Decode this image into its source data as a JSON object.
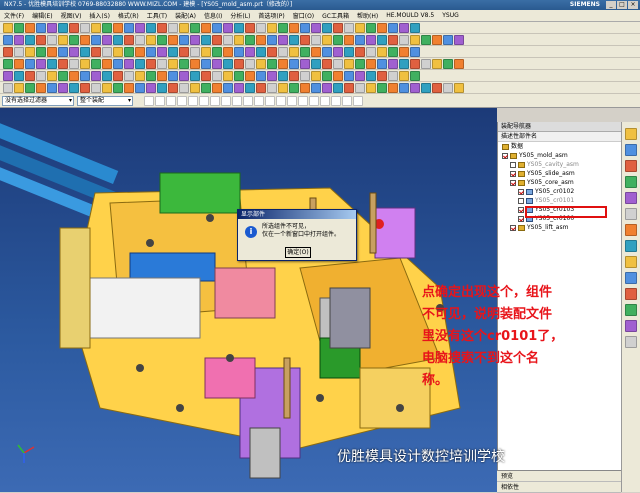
{
  "window": {
    "title": "NX7.5 - 优胜模具培训学校 0769-88032880 WWW.MIZL.COM - 建模 - [YS05_mold_asm.prt（修改的）]",
    "brand": "SIEMENS",
    "win_buttons": [
      "_",
      "□",
      "×"
    ]
  },
  "menu": [
    "文件(F)",
    "编辑(E)",
    "视图(V)",
    "插入(S)",
    "格式(R)",
    "工具(T)",
    "装配(A)",
    "信息(I)",
    "分析(L)",
    "首选项(P)",
    "窗口(O)",
    "GC工具箱",
    "帮助(H)",
    "HE.MOULD V8.5",
    "YSUG"
  ],
  "selection": {
    "filter_value": "没有选择过滤器",
    "scope_value": "整个装配"
  },
  "navigator": {
    "title": "装配导航器",
    "column": "描述性部件名",
    "items": [
      {
        "label": "数据",
        "kind": "folder",
        "indent": 0,
        "checked": false
      },
      {
        "label": "YS05_mold_asm",
        "kind": "asm",
        "indent": 0,
        "checked": true
      },
      {
        "label": "YS05_cavity_asm",
        "kind": "asm",
        "indent": 1,
        "checked": false
      },
      {
        "label": "YS05_slide_asm",
        "kind": "asm",
        "indent": 1,
        "checked": true
      },
      {
        "label": "YS05_core_asm",
        "kind": "asm",
        "indent": 1,
        "checked": true
      },
      {
        "label": "YS05_cr0102",
        "kind": "prt",
        "indent": 2,
        "checked": true
      },
      {
        "label": "YS05_cr0101",
        "kind": "prt",
        "indent": 2,
        "checked": false,
        "highlight": true
      },
      {
        "label": "YS05_cr0103",
        "kind": "prt",
        "indent": 2,
        "checked": true
      },
      {
        "label": "YS05_cr0100",
        "kind": "prt",
        "indent": 2,
        "checked": true
      },
      {
        "label": "YS05_lift_asm",
        "kind": "asm",
        "indent": 1,
        "checked": true
      }
    ],
    "bottom": [
      "预览",
      "相依性"
    ]
  },
  "dialog": {
    "title": "显示部件",
    "lines": [
      "所选组件不可见，",
      "仅在一个新窗口中打开组件。"
    ],
    "ok_label": "确定(O)"
  },
  "annotation": {
    "lines": [
      "点确定出现这个，组件",
      "不可见，说明装配文件",
      "里没有这个cr0101了，",
      "电脑搜索不到这个名",
      "称。"
    ]
  },
  "watermark": "优胜模具设计数控培训学校",
  "colors": {
    "annotation": "#e8141a",
    "highlight_box": "#e01010",
    "viewport": "#2c5aa0"
  }
}
